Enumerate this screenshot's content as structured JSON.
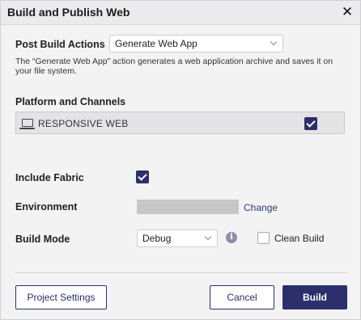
{
  "window": {
    "title": "Build and Publish Web",
    "close_glyph": "✕"
  },
  "post_build": {
    "label": "Post Build Actions",
    "selected": "Generate Web App",
    "description": "The “Generate Web App” action generates a web application archive and saves it on your file system."
  },
  "platform": {
    "heading": "Platform and Channels",
    "channel_label": "RESPONSIVE WEB",
    "channel_checked": true
  },
  "fabric": {
    "label": "Include Fabric",
    "checked": true
  },
  "environment": {
    "label": "Environment",
    "value": "",
    "change_label": "Change"
  },
  "build_mode": {
    "label": "Build Mode",
    "selected": "Debug",
    "info_glyph": "i",
    "clean_build_label": "Clean Build",
    "clean_build_checked": false
  },
  "footer": {
    "project_settings_label": "Project Settings",
    "cancel_label": "Cancel",
    "build_label": "Build"
  },
  "colors": {
    "primary": "#2b2f6b",
    "link": "#2b3a7a",
    "background": "#f3f3f4"
  }
}
